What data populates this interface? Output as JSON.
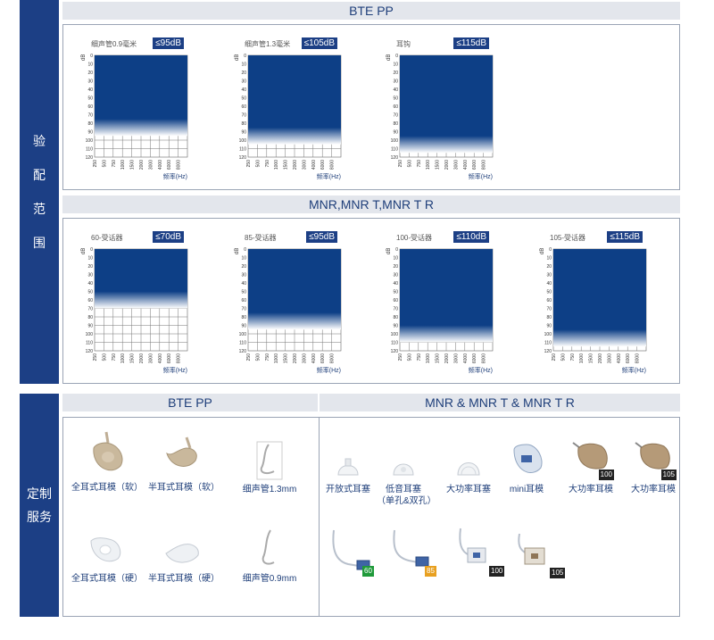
{
  "side": {
    "fit_chars": [
      "验",
      "配",
      "范",
      "围"
    ],
    "custom_lines": [
      "定制",
      "服务"
    ]
  },
  "headers": {
    "bte_pp": "BTE PP",
    "mnr": "MNR,MNR T,MNR T R",
    "custom_bte": "BTE PP",
    "custom_mnr": "MNR & MNR T & MNR T R"
  },
  "axis": {
    "db_unit": "dB",
    "y_ticks": [
      "0",
      "10",
      "20",
      "30",
      "40",
      "50",
      "60",
      "70",
      "80",
      "90",
      "100",
      "110",
      "120"
    ],
    "x_ticks": [
      "250",
      "500",
      "750",
      "1000",
      "1500",
      "2000",
      "3000",
      "4000",
      "6000",
      "8000"
    ],
    "x_label": "频率(Hz)"
  },
  "chart_data": [
    {
      "type": "area",
      "label": "细声管0.9毫米",
      "limit_label": "≤95dB",
      "max_db": 95,
      "ylim": [
        0,
        120
      ]
    },
    {
      "type": "area",
      "label": "细声管1.3毫米",
      "limit_label": "≤105dB",
      "max_db": 105,
      "ylim": [
        0,
        120
      ]
    },
    {
      "type": "area",
      "label": "耳钩",
      "limit_label": "≤115dB",
      "max_db": 115,
      "ylim": [
        0,
        120
      ]
    },
    {
      "type": "area",
      "label": "60-受话器",
      "limit_label": "≤70dB",
      "max_db": 70,
      "ylim": [
        0,
        120
      ]
    },
    {
      "type": "area",
      "label": "85-受话器",
      "limit_label": "≤95dB",
      "max_db": 95,
      "ylim": [
        0,
        120
      ]
    },
    {
      "type": "area",
      "label": "100-受话器",
      "limit_label": "≤110dB",
      "max_db": 110,
      "ylim": [
        0,
        120
      ]
    },
    {
      "type": "area",
      "label": "105-受话器",
      "limit_label": "≤115dB",
      "max_db": 115,
      "ylim": [
        0,
        120
      ]
    }
  ],
  "bte_products": [
    {
      "name": "全耳式耳模（软）"
    },
    {
      "name": "半耳式耳模（软）"
    },
    {
      "name": "细声管1.3mm"
    },
    {
      "name": "全耳式耳模（硬）"
    },
    {
      "name": "半耳式耳模（硬）"
    },
    {
      "name": "细声管0.9mm"
    }
  ],
  "mnr_products": [
    {
      "line1": "开放式耳塞",
      "line2": ""
    },
    {
      "line1": "低音耳塞",
      "line2": "（单孔&双孔）"
    },
    {
      "line1": "大功率耳塞",
      "line2": ""
    },
    {
      "line1": "mini耳模",
      "line2": ""
    },
    {
      "line1": "大功率耳模",
      "line2": "",
      "badge": "100"
    },
    {
      "line1": "大功率耳模",
      "line2": "",
      "badge": "105"
    }
  ],
  "receivers": [
    {
      "badge": "60",
      "color": "#1f9a3a"
    },
    {
      "badge": "85",
      "color": "#e8a020"
    },
    {
      "badge": "100",
      "color": "#222222"
    },
    {
      "badge": "105",
      "color": "#222222"
    }
  ]
}
